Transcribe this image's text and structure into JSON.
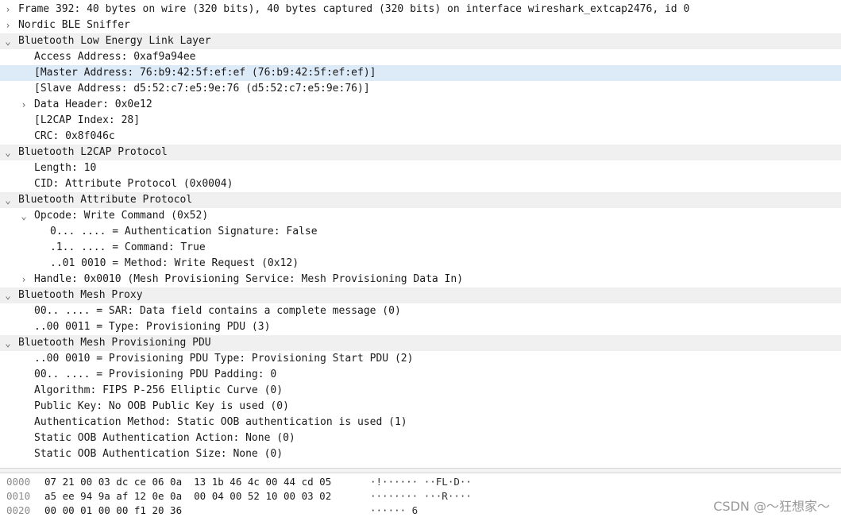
{
  "tree": [
    {
      "text": "Frame 392: 40 bytes on wire (320 bits), 40 bytes captured (320 bits) on interface wireshark_extcap2476, id 0",
      "level": 0,
      "twisty": "›"
    },
    {
      "text": "Nordic BLE Sniffer",
      "level": 0,
      "twisty": "›"
    },
    {
      "text": "Bluetooth Low Energy Link Layer",
      "level": 0,
      "twisty": "⌄",
      "header": true
    },
    {
      "text": "Access Address: 0xaf9a94ee",
      "level": 1
    },
    {
      "text": "[Master Address: 76:b9:42:5f:ef:ef (76:b9:42:5f:ef:ef)]",
      "level": 1,
      "selected": true
    },
    {
      "text": "[Slave Address: d5:52:c7:e5:9e:76 (d5:52:c7:e5:9e:76)]",
      "level": 1
    },
    {
      "text": "Data Header: 0x0e12",
      "level": 1,
      "twisty": "›"
    },
    {
      "text": "[L2CAP Index: 28]",
      "level": 1
    },
    {
      "text": "CRC: 0x8f046c",
      "level": 1
    },
    {
      "text": "Bluetooth L2CAP Protocol",
      "level": 0,
      "twisty": "⌄",
      "header": true
    },
    {
      "text": "Length: 10",
      "level": 1
    },
    {
      "text": "CID: Attribute Protocol (0x0004)",
      "level": 1
    },
    {
      "text": "Bluetooth Attribute Protocol",
      "level": 0,
      "twisty": "⌄",
      "header": true
    },
    {
      "text": "Opcode: Write Command (0x52)",
      "level": 1,
      "twisty": "⌄"
    },
    {
      "text": "0... .... = Authentication Signature: False",
      "level": 2
    },
    {
      "text": ".1.. .... = Command: True",
      "level": 2
    },
    {
      "text": "..01 0010 = Method: Write Request (0x12)",
      "level": 2
    },
    {
      "text": "Handle: 0x0010 (Mesh Provisioning Service: Mesh Provisioning Data In)",
      "level": 1,
      "twisty": "›"
    },
    {
      "text": "Bluetooth Mesh Proxy",
      "level": 0,
      "twisty": "⌄",
      "header": true
    },
    {
      "text": "00.. .... = SAR: Data field contains a complete message (0)",
      "level": 1
    },
    {
      "text": "..00 0011 = Type: Provisioning PDU (3)",
      "level": 1
    },
    {
      "text": "Bluetooth Mesh Provisioning PDU",
      "level": 0,
      "twisty": "⌄",
      "header": true
    },
    {
      "text": "..00 0010 = Provisioning PDU Type: Provisioning Start PDU (2)",
      "level": 1
    },
    {
      "text": "00.. .... = Provisioning PDU Padding: 0",
      "level": 1
    },
    {
      "text": "Algorithm: FIPS P-256 Elliptic Curve (0)",
      "level": 1
    },
    {
      "text": "Public Key: No OOB Public Key is used (0)",
      "level": 1
    },
    {
      "text": "Authentication Method: Static OOB authentication is used (1)",
      "level": 1
    },
    {
      "text": "Static OOB Authentication Action: None (0)",
      "level": 1
    },
    {
      "text": "Static OOB Authentication Size: None (0)",
      "level": 1
    }
  ],
  "hex": [
    {
      "offset": "0000",
      "bytes": "07 21 00 03 dc ce 06 0a  13 1b 46 4c 00 44 cd 05",
      "ascii": "·!······ ··FL·D··"
    },
    {
      "offset": "0010",
      "bytes": "a5 ee 94 9a af 12 0e 0a  00 04 00 52 10 00 03 02",
      "ascii": "········ ···R····"
    },
    {
      "offset": "0020",
      "bytes": "00 00 01 00 00 f1 20 36",
      "ascii": "······ 6"
    }
  ],
  "watermark": "CSDN @～狂想家～"
}
